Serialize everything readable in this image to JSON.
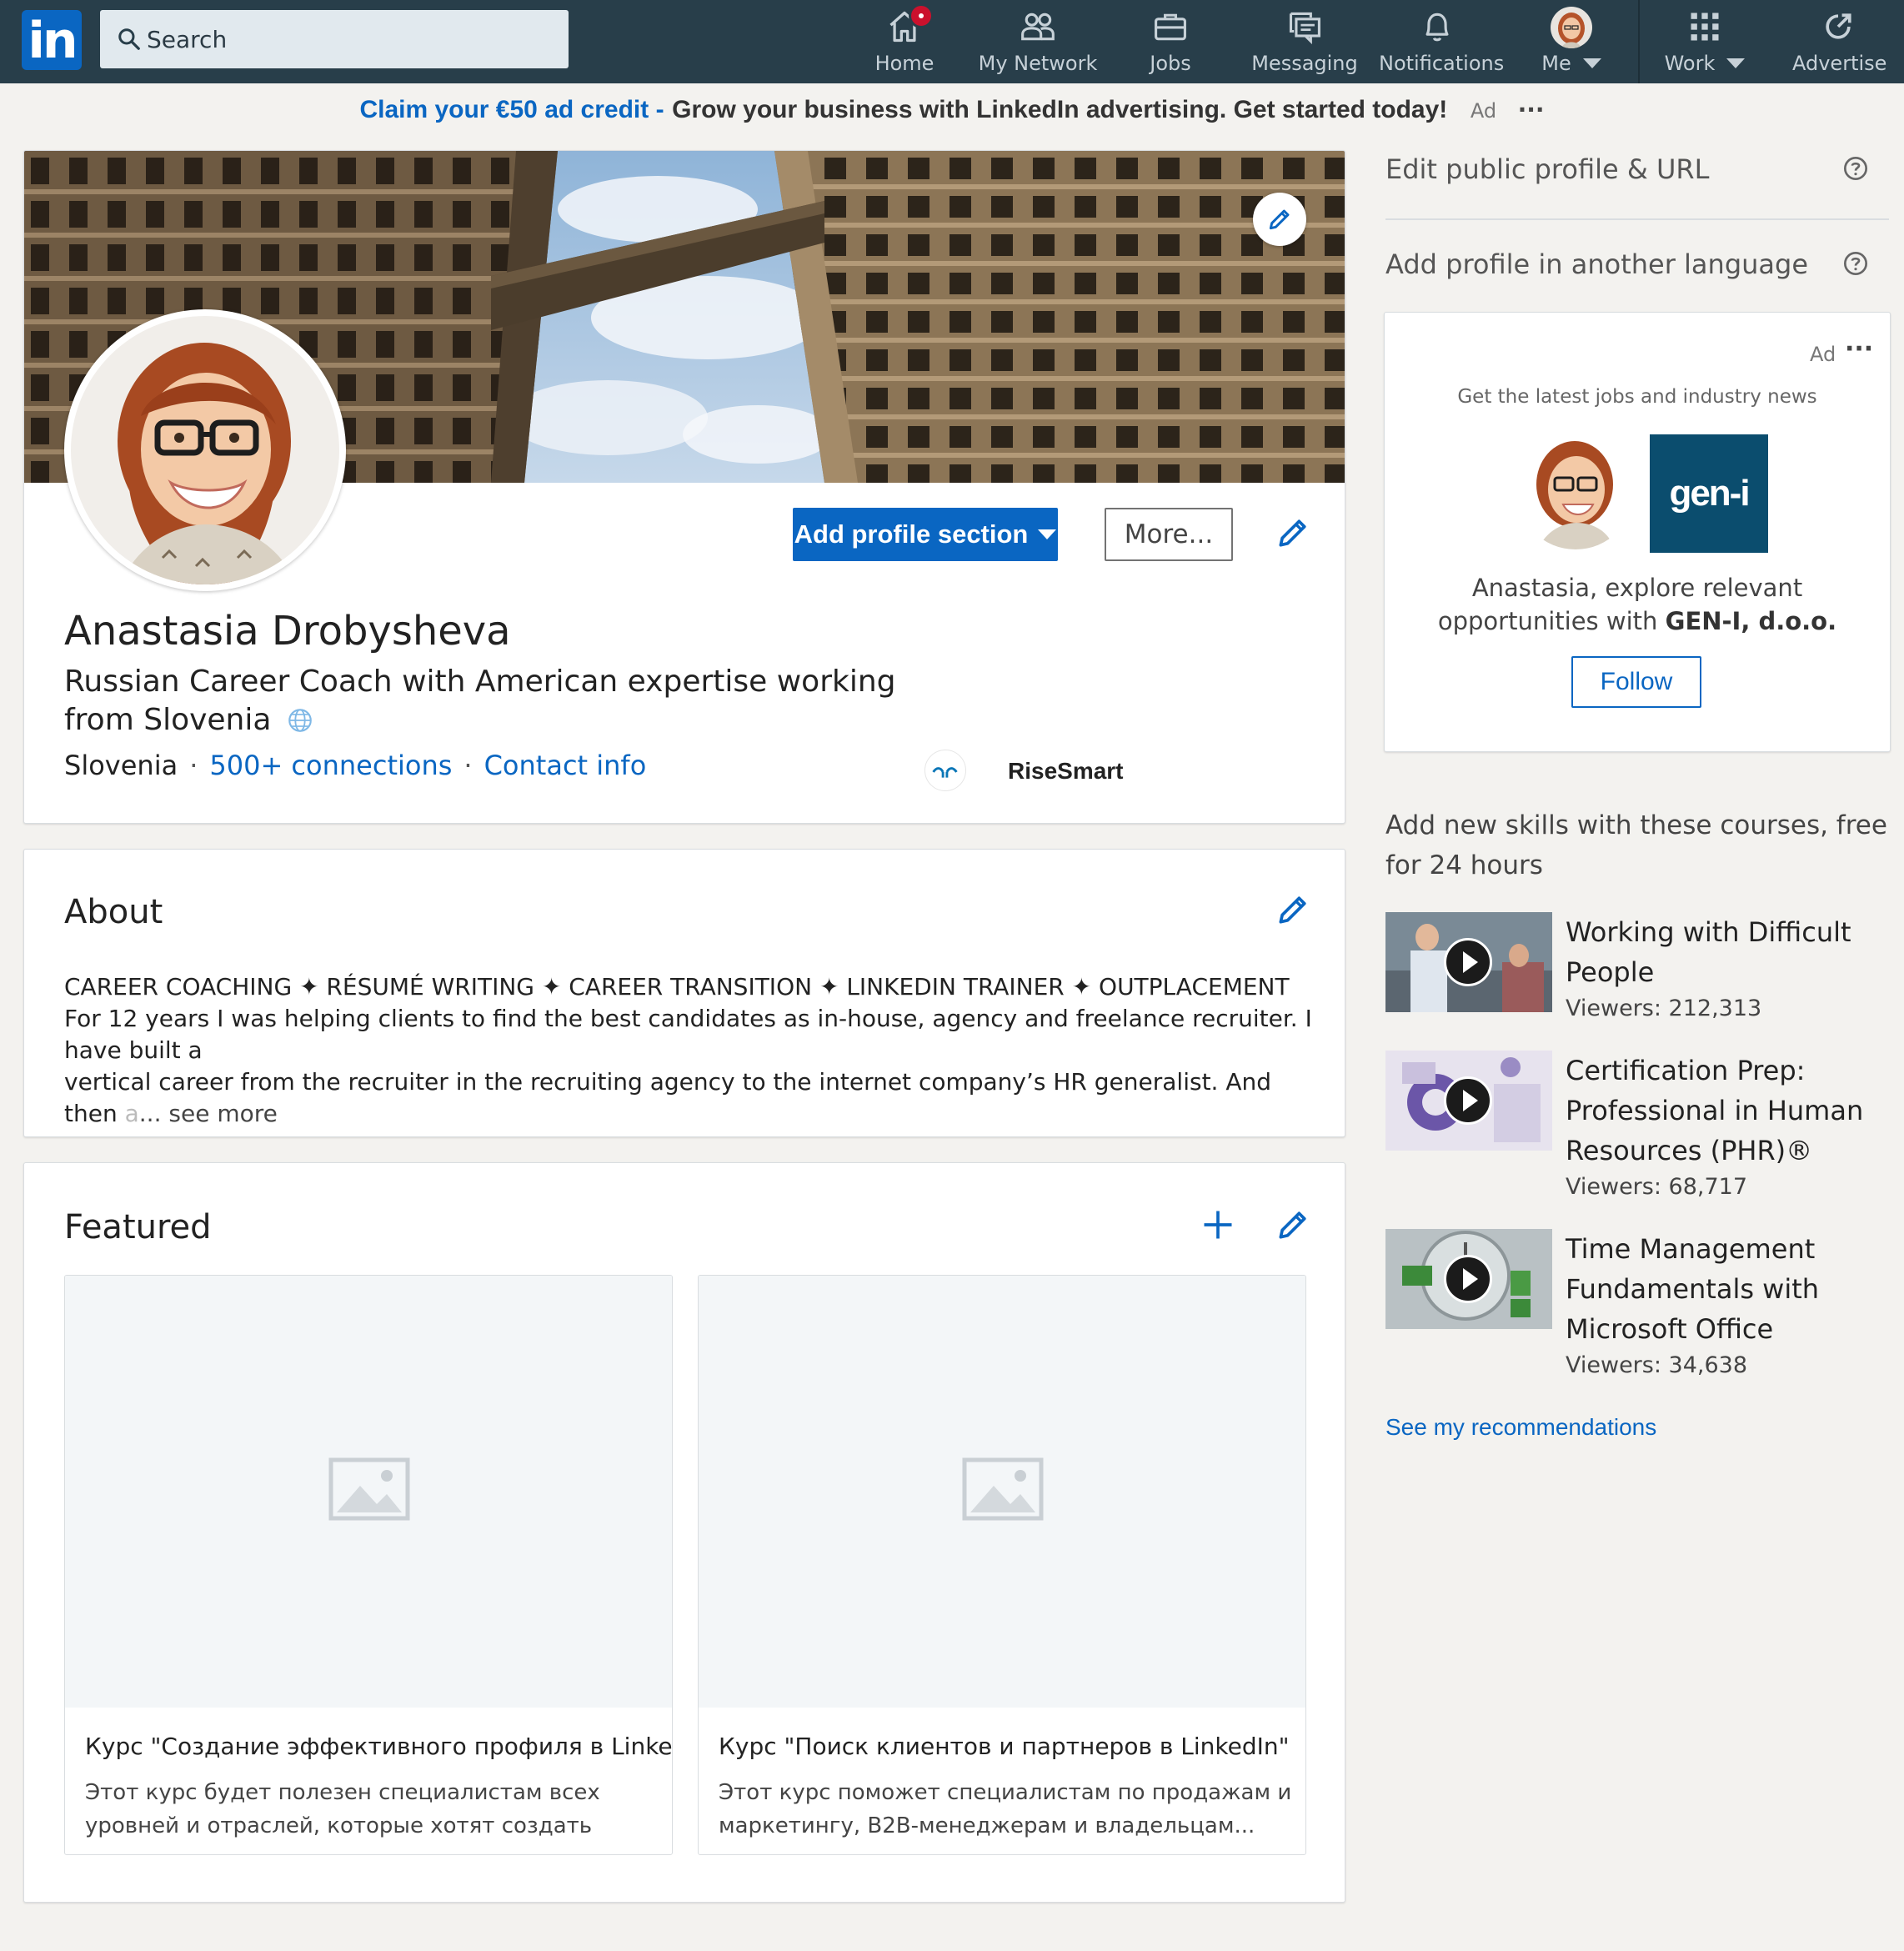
{
  "colors": {
    "nav_bg": "#283e4a",
    "brand_blue": "#0a66c2",
    "page_bg": "#f3f2ef",
    "notification_red": "#cb112d"
  },
  "nav": {
    "logo_text": "in",
    "search_placeholder": "Search",
    "items": [
      {
        "label": "Home",
        "icon": "home-icon",
        "has_badge": true
      },
      {
        "label": "My Network",
        "icon": "my-network-icon"
      },
      {
        "label": "Jobs",
        "icon": "jobs-icon"
      },
      {
        "label": "Messaging",
        "icon": "messaging-icon"
      },
      {
        "label": "Notifications",
        "icon": "bell-icon"
      },
      {
        "label": "Me",
        "icon": "avatar"
      },
      {
        "label": "Work",
        "icon": "grid-icon"
      },
      {
        "label": "Advertise",
        "icon": "advertise-icon"
      }
    ]
  },
  "ad_banner": {
    "claim": "Claim your €50 ad credit -",
    "message": "Grow your business with LinkedIn advertising. Get started today!",
    "ad_label": "Ad",
    "more": "···"
  },
  "profile": {
    "add_section_label": "Add profile section",
    "more_label": "More...",
    "name": "Anastasia Drobysheva",
    "headline": "Russian Career Coach with American expertise working from Slovenia",
    "location": "Slovenia",
    "separator": "·",
    "connections": "500+ connections",
    "contact": "Contact info",
    "company": "RiseSmart"
  },
  "about": {
    "title": "About",
    "line1": "CAREER COACHING ✦ RÉSUMÉ WRITING ✦ CAREER TRANSITION ✦ LINKEDIN TRAINER ✦ OUTPLACEMENT",
    "line2": "For 12 years I was helping clients to find the best candidates as in-house, agency and freelance recruiter. I have built a",
    "line3": "vertical career from the recruiter in the recruiting agency to the internet company’s HR generalist. And then",
    "line3_fade": "a",
    "see_more": "... see more"
  },
  "featured": {
    "title": "Featured",
    "items": [
      {
        "title": "Курс \"Создание эффективного профиля в LinkedIn\"",
        "desc": "Этот курс будет полезен специалистам всех уровней и отраслей, которые хотят создать или..."
      },
      {
        "title": "Курс \"Поиск клиентов и партнеров в LinkedIn\"",
        "desc": "Этот курс поможет специалистам по продажам и маркетингу, B2B-менеджерам и владельцам..."
      }
    ]
  },
  "rail": {
    "edit_public": "Edit public profile & URL",
    "add_language": "Add profile in another language",
    "ad": {
      "label": "Ad",
      "more": "···",
      "tagline": "Get the latest jobs and industry news",
      "company_logo_text": "gen-i",
      "message_prefix": "Anastasia, explore relevant opportunities with",
      "company": "GEN-I, d.o.o.",
      "follow": "Follow"
    },
    "courses_title": "Add new skills with these courses, free for 24 hours",
    "courses": [
      {
        "title": "Working with Difficult People",
        "viewers": "Viewers: 212,313"
      },
      {
        "title": "Certification Prep: Professional in Human Resources (PHR)®",
        "viewers": "Viewers: 68,717"
      },
      {
        "title": "Time Management Fundamentals with Microsoft Office",
        "viewers": "Viewers: 34,638"
      }
    ],
    "see_recommendations": "See my recommendations"
  }
}
